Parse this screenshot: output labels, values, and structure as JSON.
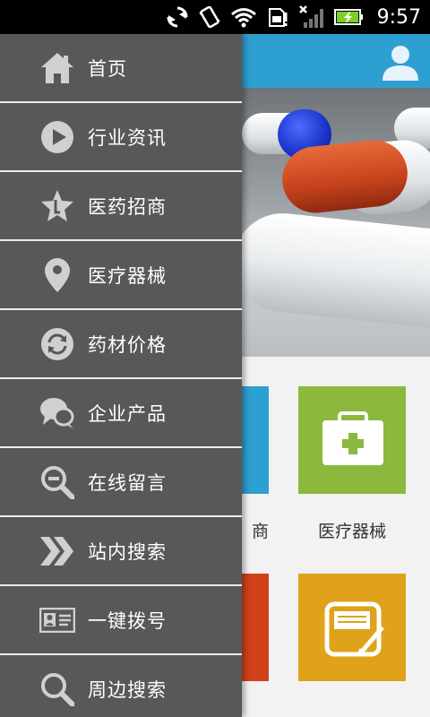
{
  "status_bar": {
    "time": "9:57",
    "icons": [
      "sync-icon",
      "vibrate-icon",
      "wifi-icon",
      "sd-card-icon",
      "no-signal-icon",
      "battery-charging-icon"
    ]
  },
  "background_app": {
    "header_color": "#2e9fd1",
    "user_icon": "user-icon",
    "tiles": [
      {
        "label": "医疗器械",
        "color": "#8cb83e",
        "icon": "medical-kit-icon"
      },
      {
        "label": "商",
        "color": "#2e9fd1"
      },
      {
        "label": "",
        "color": "#d1421a"
      },
      {
        "label": "",
        "color": "#e0a21a",
        "icon": "notepad-icon"
      }
    ]
  },
  "drawer": {
    "items": [
      {
        "label": "首页",
        "icon": "home-icon"
      },
      {
        "label": "行业资讯",
        "icon": "play-icon"
      },
      {
        "label": "医药招商",
        "icon": "star-icon"
      },
      {
        "label": "医疗器械",
        "icon": "location-pin-icon"
      },
      {
        "label": "药材价格",
        "icon": "refresh-icon"
      },
      {
        "label": "企业产品",
        "icon": "chat-icon"
      },
      {
        "label": "在线留言",
        "icon": "zoom-out-icon"
      },
      {
        "label": "站内搜索",
        "icon": "double-chevron-icon"
      },
      {
        "label": "一键拨号",
        "icon": "id-card-icon"
      },
      {
        "label": "周边搜索",
        "icon": "search-icon"
      }
    ]
  }
}
